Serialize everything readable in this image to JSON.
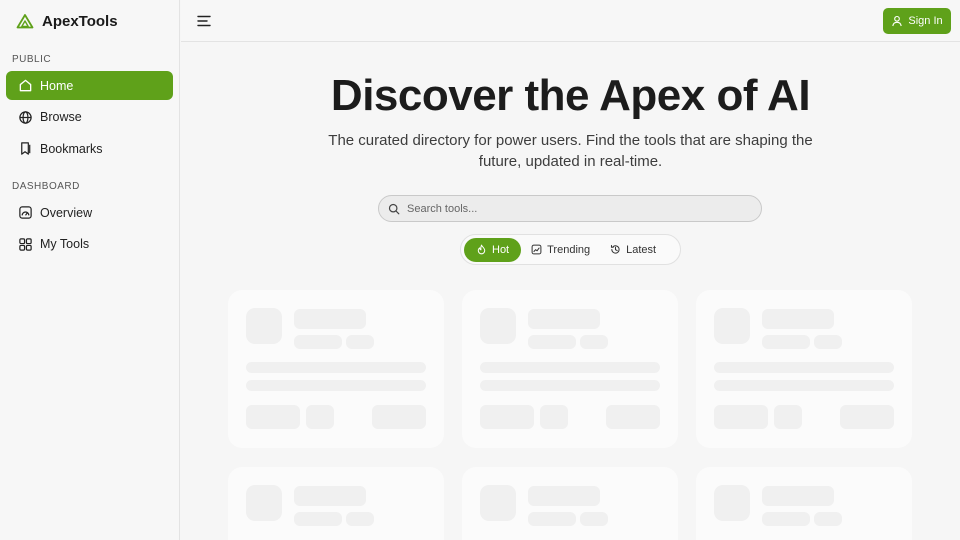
{
  "app": {
    "name": "ApexTools",
    "brand_color": "#5fa11a"
  },
  "sidebar": {
    "sections": [
      {
        "title": "PUBLIC",
        "items": [
          {
            "label": "Home",
            "icon": "home-icon",
            "active": true
          },
          {
            "label": "Browse",
            "icon": "globe-icon",
            "active": false
          },
          {
            "label": "Bookmarks",
            "icon": "bookmark-icon",
            "active": false
          }
        ]
      },
      {
        "title": "DASHBOARD",
        "items": [
          {
            "label": "Overview",
            "icon": "dashboard-icon",
            "active": false
          },
          {
            "label": "My Tools",
            "icon": "grid-icon",
            "active": false
          }
        ]
      }
    ]
  },
  "topbar": {
    "menu_icon": "menu-icon",
    "signin_label": "Sign In",
    "signin_icon": "user-icon"
  },
  "hero": {
    "title": "Discover the Apex of AI",
    "subtitle": "The curated directory for power users. Find the tools that are shaping the future, updated in real-time."
  },
  "search": {
    "placeholder": "Search tools...",
    "value": ""
  },
  "tabs": [
    {
      "label": "Hot",
      "icon": "flame-icon",
      "active": true
    },
    {
      "label": "Trending",
      "icon": "trending-chart-icon",
      "active": false
    },
    {
      "label": "Latest",
      "icon": "history-icon",
      "active": false
    }
  ]
}
